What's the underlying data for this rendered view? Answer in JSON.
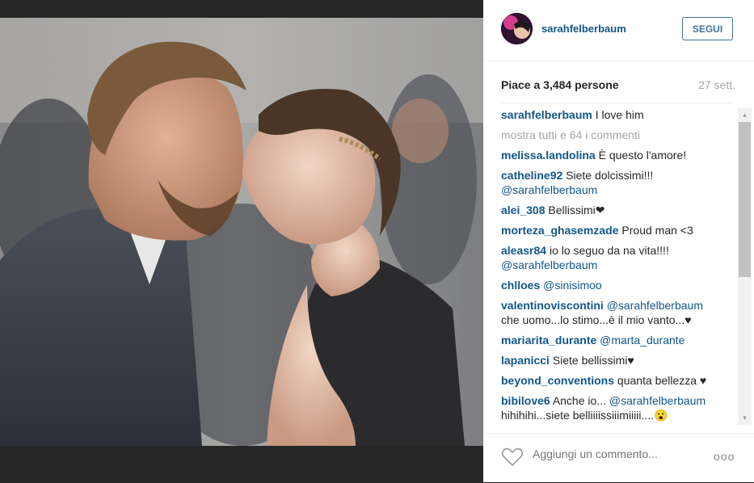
{
  "post": {
    "username": "sarahfelberbaum",
    "follow_label": "SEGUI",
    "likes_text": "Piace a 3,484 persone",
    "time_ago": "27 sett.",
    "show_all_label": "mostra tutti e 64 i commenti",
    "caption": {
      "user": "sarahfelberbaum",
      "text": "I love him"
    },
    "comments": [
      {
        "user": "melissa.landolina",
        "mention": "",
        "text": "È questo l'amore!"
      },
      {
        "user": "catheline92",
        "mention": "",
        "text": "Siete dolcissimi!!!",
        "mention_after": "@sarahfelberbaum"
      },
      {
        "user": "alei_308",
        "mention": "",
        "text": "Bellissimi❤"
      },
      {
        "user": "morteza_ghasemzade",
        "mention": "",
        "text": "Proud man <3"
      },
      {
        "user": "aleasr84",
        "mention": "",
        "text": "io lo seguo da na vita!!!!",
        "mention_after": "@sarahfelberbaum"
      },
      {
        "user": "chlloes",
        "mention": "@sinisimoo",
        "text": ""
      },
      {
        "user": "valentinoviscontini",
        "mention": "@sarahfelberbaum",
        "text": "che uomo...lo stimo...è il mio vanto...♥"
      },
      {
        "user": "mariarita_durante",
        "mention": "@marta_durante",
        "text": ""
      },
      {
        "user": "lapanicci",
        "mention": "",
        "text": "Siete bellissimi♥"
      },
      {
        "user": "beyond_conventions",
        "mention": "",
        "text": "quanta bellezza ♥"
      },
      {
        "user": "bibilove6",
        "mention": "",
        "text": "Anche io...",
        "mention_after": "@sarahfelberbaum",
        "text_after": "hihihihi...siete belliiiissiiimiiiii....😮"
      }
    ],
    "add_comment_placeholder": "Aggiungi un commento...",
    "more_label": "ooo"
  }
}
